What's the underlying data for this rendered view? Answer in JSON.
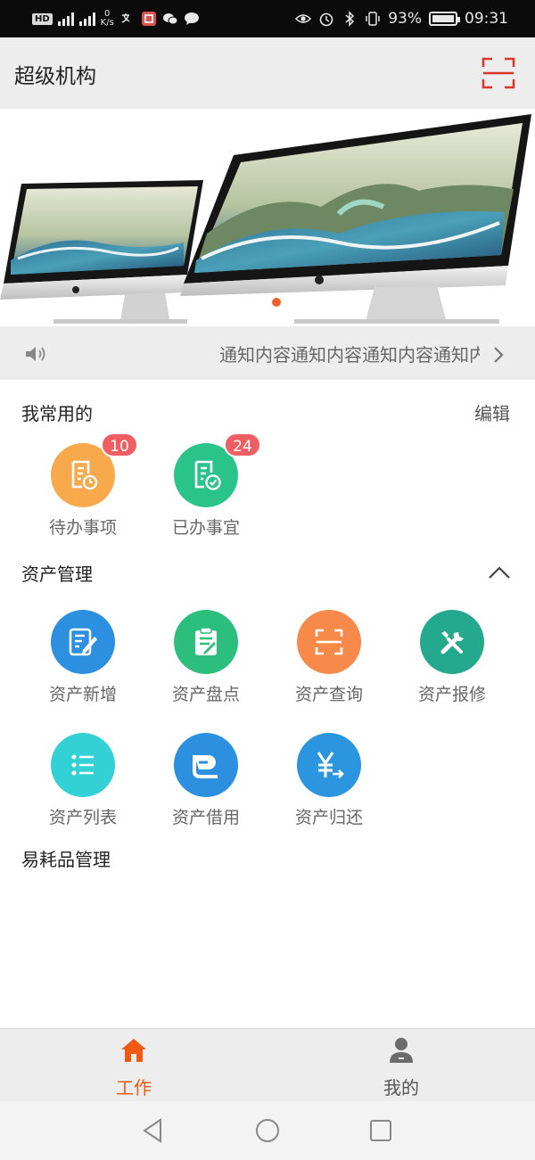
{
  "status_bar": {
    "hd_tag": "HD",
    "net_speed_value": "0",
    "net_speed_unit": "K/s",
    "battery": "93%",
    "time": "09:31"
  },
  "header": {
    "title": "超级机构"
  },
  "notice": {
    "text": "通知内容通知内容通知内容通知内容"
  },
  "favorites": {
    "title": "我常用的",
    "edit_label": "编辑",
    "items": [
      {
        "label": "待办事项",
        "badge": "10",
        "color": "#f7a94c",
        "icon": "todo-clock-icon"
      },
      {
        "label": "已办事宜",
        "badge": "24",
        "color": "#2ac48a",
        "icon": "done-check-icon"
      }
    ]
  },
  "asset_management": {
    "title": "资产管理",
    "items": [
      {
        "label": "资产新增",
        "color": "#2c8fe0",
        "icon": "edit-doc-icon"
      },
      {
        "label": "资产盘点",
        "color": "#2cbe7c",
        "icon": "clipboard-icon"
      },
      {
        "label": "资产查询",
        "color": "#f78a4a",
        "icon": "scan-icon"
      },
      {
        "label": "资产报修",
        "color": "#24a98f",
        "icon": "tools-icon"
      },
      {
        "label": "资产列表",
        "color": "#33d0d6",
        "icon": "list-icon"
      },
      {
        "label": "资产借用",
        "color": "#2c8fe0",
        "icon": "borrow-icon"
      },
      {
        "label": "资产归还",
        "color": "#2c95e0",
        "icon": "yen-return-icon"
      }
    ]
  },
  "consumables": {
    "title": "易耗品管理"
  },
  "tabs": [
    {
      "label": "工作",
      "active": true,
      "color": "#f05a12"
    },
    {
      "label": "我的",
      "active": false,
      "color": "#555555"
    }
  ]
}
